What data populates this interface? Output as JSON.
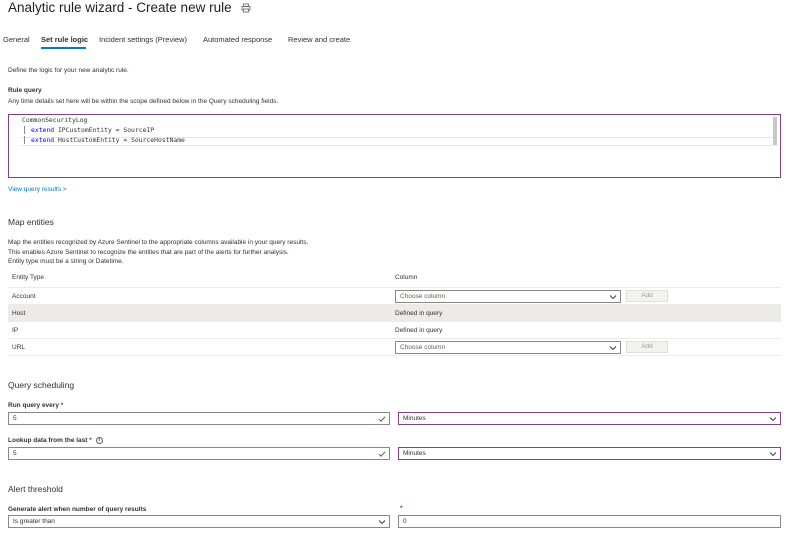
{
  "header": {
    "title": "Analytic rule wizard - Create new rule",
    "print_icon": "print-icon"
  },
  "tabs": [
    {
      "label": "General",
      "active": false
    },
    {
      "label": "Set rule logic",
      "active": true
    },
    {
      "label": "Incident settings (Preview)",
      "active": false
    },
    {
      "label": "Automated response",
      "active": false
    },
    {
      "label": "Review and create",
      "active": false
    }
  ],
  "intro": "Define the logic for your new analytic rule.",
  "rule_query": {
    "label": "Rule query",
    "help": "Any time details set here will be within the scope defined below in the Query scheduling fields.",
    "lines": [
      {
        "keyword": "",
        "text": "CommonSecurityLog"
      },
      {
        "keyword": "extend",
        "text": " IPCustomEntity = SourceIP"
      },
      {
        "keyword": "extend",
        "text": " HostCustomEntity = SourceHostName"
      }
    ],
    "view_results_link": "View query results >"
  },
  "map_entities": {
    "title": "Map entities",
    "description_lines": [
      "Map the entities recognized by Azure Sentinel to the appropriate columns available in your query results.",
      "This enables Azure Sentinel to recognize the entities that are part of the alerts for further analysis.",
      "Entity type must be a string or Datetime."
    ],
    "columns": [
      "Entity Type",
      "Column"
    ],
    "rows": [
      {
        "entity": "Account",
        "column": "Choose column",
        "has_dropdown": true,
        "add_label": "Add"
      },
      {
        "entity": "Host",
        "column": "Defined in query",
        "has_dropdown": false,
        "add_label": ""
      },
      {
        "entity": "IP",
        "column": "Defined in query",
        "has_dropdown": false,
        "add_label": ""
      },
      {
        "entity": "URL",
        "column": "Choose column",
        "has_dropdown": true,
        "add_label": "Add"
      }
    ]
  },
  "query_scheduling": {
    "title": "Query scheduling",
    "run_every_label": "Run query every",
    "run_every_value": "5",
    "run_every_unit": "Minutes",
    "lookup_label": "Lookup data from the last",
    "lookup_value": "5",
    "lookup_unit": "Minutes",
    "required_mark": "*"
  },
  "alert_threshold": {
    "title": "Alert threshold",
    "label": "Generate alert when number of query results",
    "operator": "Is greater than",
    "value": "0",
    "required_mark": "*"
  },
  "colors": {
    "accent": "#0078d4",
    "focus_border": "#8a3d8f",
    "valid_check": "#107c10",
    "required": "#a4262c"
  }
}
